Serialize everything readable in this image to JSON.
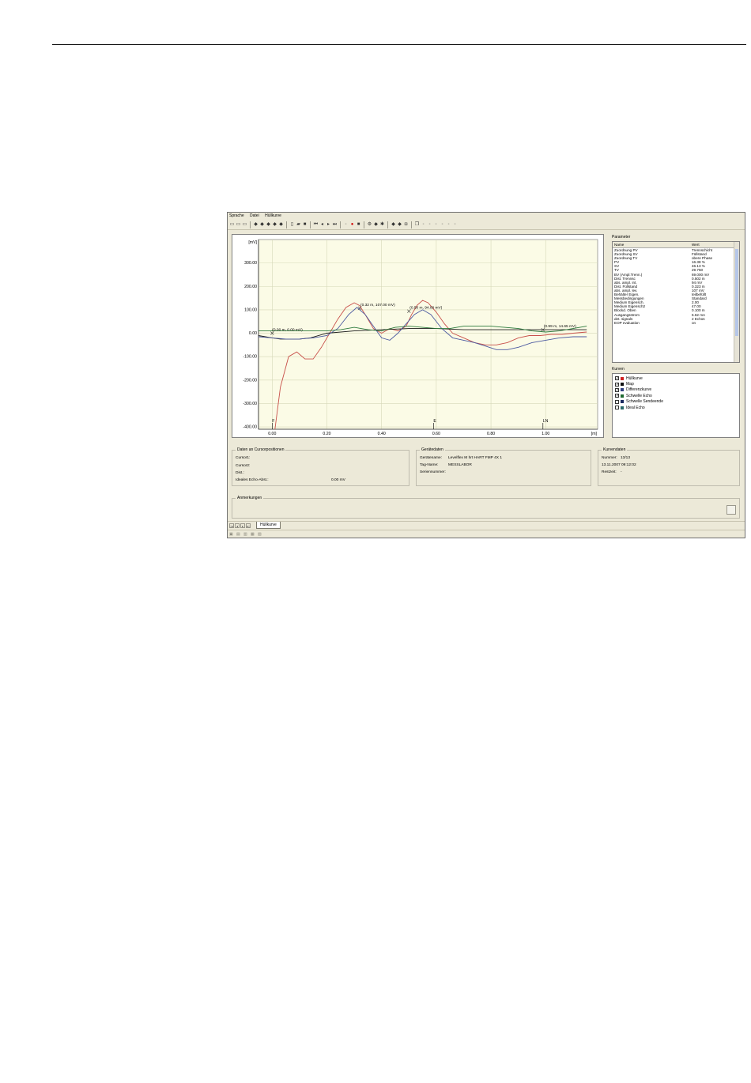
{
  "menu": [
    "Sprache",
    "Datei",
    "Hüllkurve"
  ],
  "toolbar_icons": [
    "layout-icon",
    "layout-icon",
    "layout-icon",
    "sep",
    "tool-icon",
    "tool-icon",
    "tool-icon",
    "tool-icon",
    "tool-icon",
    "sep",
    "new-file-icon",
    "open-folder-icon",
    "save-icon",
    "sep",
    "first-icon",
    "prev-icon",
    "next-icon",
    "last-icon",
    "sep",
    "disabled-icon",
    "record-icon",
    "stop-icon",
    "sep",
    "filter-icon",
    "tool-icon",
    "settings-icon",
    "sep",
    "tool-icon",
    "tool-icon",
    "lock-icon",
    "sep",
    "copy-icon",
    "disabled-icon",
    "disabled-icon",
    "disabled-icon",
    "disabled-icon",
    "disabled-icon",
    "disabled-icon"
  ],
  "chart_data": {
    "type": "line",
    "ylabel": "[mV]",
    "xlabel": "[m]",
    "yticks": [
      "300.00",
      "200.00",
      "100.00",
      "0.00",
      "-100.00",
      "-200.00",
      "-300.00",
      "-400.00"
    ],
    "xticks": [
      "0.00",
      "0.20",
      "0.40",
      "0.60",
      "0.80",
      "1.00"
    ],
    "xlim": [
      -0.05,
      1.19
    ],
    "ylim": [
      -410,
      400
    ],
    "markers": [
      {
        "label": "F",
        "x": 0.0
      },
      {
        "label": "E",
        "x": 0.59
      },
      {
        "label": "LN",
        "x": 0.99
      }
    ],
    "annotations": [
      {
        "text": "(0.00 m, 0.00 mV)",
        "x": 0.0,
        "y": 0.0
      },
      {
        "text": "(0.32 m, 107.00 mV)",
        "x": 0.32,
        "y": 107
      },
      {
        "text": "(0.50 m, 94.00 mV)",
        "x": 0.5,
        "y": 94
      },
      {
        "text": "(0.99 m, 14.65 mV)",
        "x": 0.99,
        "y": 14.65
      }
    ],
    "series": [
      {
        "name": "Hüllkurve",
        "color": "#c8504a",
        "x": [
          0.01,
          0.03,
          0.06,
          0.09,
          0.12,
          0.15,
          0.18,
          0.21,
          0.24,
          0.27,
          0.3,
          0.32,
          0.34,
          0.37,
          0.4,
          0.43,
          0.46,
          0.49,
          0.51,
          0.53,
          0.55,
          0.57,
          0.6,
          0.63,
          0.66,
          0.7,
          0.74,
          0.78,
          0.82,
          0.86,
          0.9,
          0.94,
          0.98,
          1.02,
          1.06,
          1.1,
          1.15
        ],
        "y": [
          -410,
          -230,
          -100,
          -80,
          -110,
          -110,
          -60,
          0,
          60,
          110,
          130,
          118,
          80,
          20,
          0,
          20,
          10,
          30,
          80,
          120,
          140,
          130,
          90,
          40,
          0,
          -20,
          -40,
          -50,
          -50,
          -40,
          -20,
          -10,
          -10,
          -5,
          -5,
          0,
          5
        ]
      },
      {
        "name": "Map",
        "color": "#1a1a1a",
        "x": [
          -0.05,
          0.0,
          0.03,
          0.06,
          0.1,
          0.14,
          0.2,
          0.3,
          0.4,
          0.5,
          0.6,
          0.7,
          0.8,
          0.9,
          1.0,
          1.05,
          1.1,
          1.15
        ],
        "y": [
          -10,
          -20,
          -25,
          -25,
          -25,
          -20,
          0,
          10,
          15,
          20,
          20,
          15,
          15,
          15,
          15,
          15,
          15,
          15
        ]
      },
      {
        "name": "Differenzkurve",
        "color": "#4c5aa0",
        "x": [
          -0.05,
          0.0,
          0.05,
          0.1,
          0.15,
          0.2,
          0.24,
          0.28,
          0.31,
          0.34,
          0.37,
          0.4,
          0.43,
          0.46,
          0.49,
          0.52,
          0.55,
          0.58,
          0.62,
          0.66,
          0.7,
          0.74,
          0.78,
          0.82,
          0.86,
          0.9,
          0.95,
          1.0,
          1.05,
          1.1,
          1.15
        ],
        "y": [
          -15,
          -20,
          -25,
          -25,
          -20,
          -10,
          20,
          80,
          110,
          80,
          30,
          -20,
          -30,
          0,
          40,
          80,
          100,
          80,
          20,
          -20,
          -30,
          -40,
          -55,
          -70,
          -70,
          -60,
          -40,
          -30,
          -20,
          -15,
          -15
        ]
      },
      {
        "name": "Schwelle Echo",
        "color": "#2c7a3c",
        "x": [
          -0.05,
          0.05,
          0.15,
          0.2,
          0.25,
          0.3,
          0.35,
          0.4,
          0.45,
          0.5,
          0.55,
          0.6,
          0.65,
          0.7,
          0.75,
          0.8,
          0.85,
          0.9,
          0.95,
          1.0,
          1.05,
          1.1,
          1.15
        ],
        "y": [
          10,
          10,
          10,
          10,
          15,
          25,
          15,
          10,
          25,
          30,
          25,
          20,
          20,
          30,
          30,
          30,
          25,
          20,
          10,
          5,
          10,
          20,
          30
        ]
      }
    ]
  },
  "params": {
    "title": "Parameter",
    "col_name": "Name",
    "col_value": "Wert",
    "rows": [
      [
        "Zuordnung PV",
        "Trennschicht"
      ],
      [
        "Zuordnung SV",
        "Füllstand"
      ],
      [
        "Zuordnung TV",
        "obere Phase"
      ],
      [
        "PV",
        "16.38 %"
      ],
      [
        "SV",
        "46.13 %"
      ],
      [
        "TV",
        "29.750"
      ],
      [
        "BV (Ampl.Trenn.)",
        "69.000 mV"
      ],
      [
        "Dist. Trennsc",
        "0.502 m"
      ],
      [
        "abs. ampl. int.",
        "94 mV"
      ],
      [
        "Dist. Füllstand",
        "0.323 m"
      ],
      [
        "abs. ampl. lev.",
        "107 mV"
      ],
      [
        "Behälter Eigen.",
        "teilbefüllt"
      ],
      [
        "Messbedingungen",
        "Standard"
      ],
      [
        "Medium Eigensch.",
        "2.00"
      ],
      [
        "Medium Eigensch2",
        "47.00"
      ],
      [
        "Blockd. Oben",
        "0.100 m"
      ],
      [
        "Ausgangsstrom",
        "6.62 mA"
      ],
      [
        "det. signals",
        "2 Echos"
      ],
      [
        "EOP evaluation",
        "on"
      ]
    ]
  },
  "curves": {
    "title": "Kurven",
    "items": [
      {
        "label": "Hüllkurve",
        "checked": true,
        "color": "#d02020"
      },
      {
        "label": "Map",
        "checked": true,
        "color": "#101010"
      },
      {
        "label": "Differenzkurve",
        "checked": true,
        "color": "#304080"
      },
      {
        "label": "Schwelle Echo",
        "checked": true,
        "color": "#1f6a30"
      },
      {
        "label": "Schwelle Sendeende",
        "checked": false,
        "color": "#1a2a60"
      },
      {
        "label": "Ideal Echo",
        "checked": false,
        "color": "#2a6a6a"
      }
    ]
  },
  "cursor": {
    "title": "Daten an Cursorpositionen",
    "cursor1": "Cursor1:",
    "cursor2": "Cursor2:",
    "dist": "Dist.:",
    "ideal_label": "Ideales Echo-Abst.:",
    "ideal_value": "0.00 mV"
  },
  "device": {
    "title": "Gerätedaten",
    "name_label": "Gerätename:",
    "name_value": "Levelflex M hrt HART FMP 4X 1",
    "tag_label": "Tag-Name:",
    "tag_value": "MESSLABOR",
    "serial_label": "Seriennummer:"
  },
  "curvedata": {
    "title": "Kurvendaten",
    "number_label": "Nummer:",
    "number_value": "13/13",
    "datetime": "13.11.2007  09:12:02",
    "rest_label": "Restzeit:",
    "rest_value": "-"
  },
  "notes": {
    "title": "Anmerkungen"
  },
  "tab": {
    "label": "Hüllkurve"
  }
}
